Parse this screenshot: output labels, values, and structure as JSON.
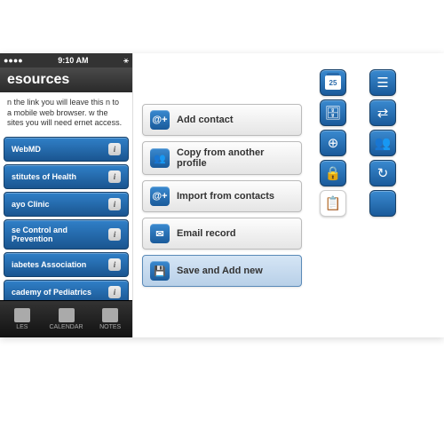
{
  "statusbar": {
    "time": "9:10 AM"
  },
  "header": {
    "title": "esources"
  },
  "description": "n the link you will leave this n to a mobile web browser. w the sites you will need ernet access.",
  "resources": [
    {
      "label": "WebMD"
    },
    {
      "label": "stitutes of Health"
    },
    {
      "label": "ayo Clinic"
    },
    {
      "label": "se Control and Prevention"
    },
    {
      "label": "iabetes Association"
    },
    {
      "label": "cademy of Pediatrics"
    }
  ],
  "tabs": [
    {
      "label": "LES"
    },
    {
      "label": "CALENDAR"
    },
    {
      "label": "NOTES"
    }
  ],
  "buttons": [
    {
      "label": "Add contact",
      "icon": "@+"
    },
    {
      "label": "Copy from another profile",
      "icon": "👥"
    },
    {
      "label": "Import from contacts",
      "icon": "@+"
    },
    {
      "label": "Email record",
      "icon": "✉"
    },
    {
      "label": "Save and Add new",
      "icon": "💾",
      "active": true
    }
  ],
  "iconGrid": [
    [
      "calendar",
      "list"
    ],
    [
      "cabinet",
      "transfer"
    ],
    [
      "medical-bag",
      "people"
    ],
    [
      "lock",
      "refresh"
    ],
    [
      "clipboard",
      "blank"
    ]
  ]
}
